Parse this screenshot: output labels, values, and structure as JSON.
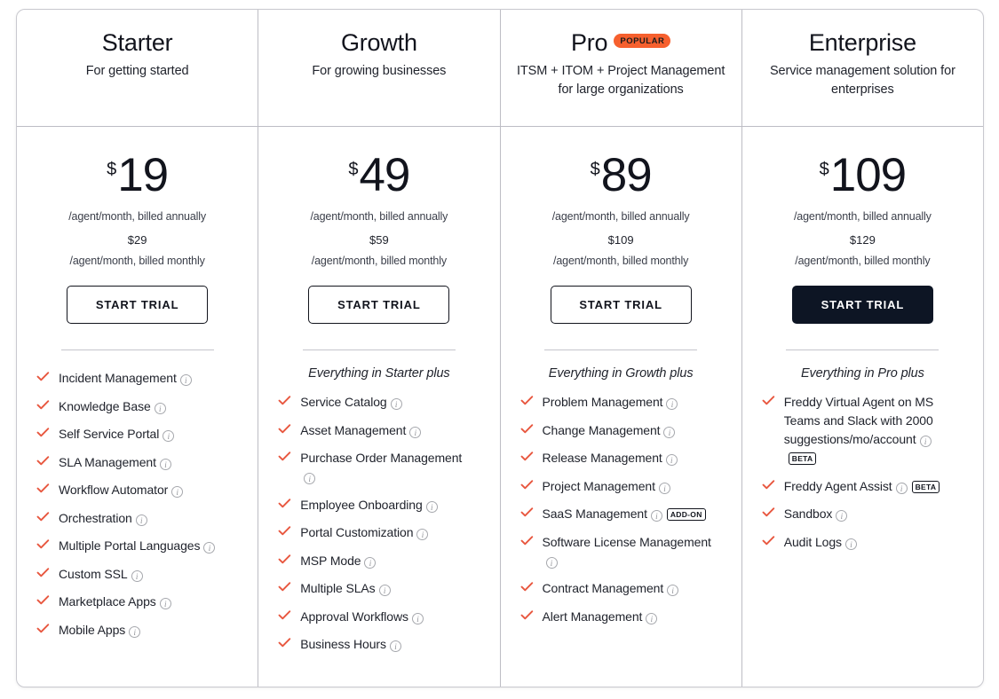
{
  "icons": {
    "check": "check-icon",
    "info": "info-icon"
  },
  "colors": {
    "check": "#e8573f",
    "popular_badge_bg": "#f6602e",
    "cta_filled_bg": "#0d1524",
    "text": "#21242d",
    "border": "#bdbdc4"
  },
  "plans": [
    {
      "name": "Starter",
      "badge": null,
      "tagline": "For getting started",
      "currency": "$",
      "price": "19",
      "price_note": "/agent/month, billed annually",
      "price_alt": "$29",
      "price_alt_note": "/agent/month, billed monthly",
      "cta_label": "START TRIAL",
      "cta_filled": false,
      "inherits": null,
      "features": [
        {
          "label": "Incident Management",
          "info": true,
          "badge": null
        },
        {
          "label": "Knowledge Base",
          "info": true,
          "badge": null
        },
        {
          "label": "Self Service Portal",
          "info": true,
          "badge": null
        },
        {
          "label": "SLA Management",
          "info": true,
          "badge": null
        },
        {
          "label": "Workflow Automator",
          "info": true,
          "badge": null
        },
        {
          "label": "Orchestration",
          "info": true,
          "badge": null
        },
        {
          "label": "Multiple Portal Languages",
          "info": true,
          "badge": null
        },
        {
          "label": "Custom SSL",
          "info": true,
          "badge": null
        },
        {
          "label": "Marketplace Apps",
          "info": true,
          "badge": null
        },
        {
          "label": "Mobile Apps",
          "info": true,
          "badge": null
        }
      ]
    },
    {
      "name": "Growth",
      "badge": null,
      "tagline": "For growing businesses",
      "currency": "$",
      "price": "49",
      "price_note": "/agent/month, billed annually",
      "price_alt": "$59",
      "price_alt_note": "/agent/month, billed monthly",
      "cta_label": "START TRIAL",
      "cta_filled": false,
      "inherits": "Everything in Starter plus",
      "features": [
        {
          "label": "Service Catalog",
          "info": true,
          "badge": null
        },
        {
          "label": "Asset Management",
          "info": true,
          "badge": null
        },
        {
          "label": "Purchase Order Management",
          "info": true,
          "badge": null
        },
        {
          "label": "Employee Onboarding",
          "info": true,
          "badge": null
        },
        {
          "label": "Portal Customization",
          "info": true,
          "badge": null
        },
        {
          "label": "MSP Mode",
          "info": true,
          "badge": null
        },
        {
          "label": "Multiple SLAs",
          "info": true,
          "badge": null
        },
        {
          "label": "Approval Workflows",
          "info": true,
          "badge": null
        },
        {
          "label": "Business Hours",
          "info": true,
          "badge": null
        }
      ]
    },
    {
      "name": "Pro",
      "badge": "POPULAR",
      "tagline": "ITSM + ITOM + Project Management for large organizations",
      "currency": "$",
      "price": "89",
      "price_note": "/agent/month, billed annually",
      "price_alt": "$109",
      "price_alt_note": "/agent/month, billed monthly",
      "cta_label": "START TRIAL",
      "cta_filled": false,
      "inherits": "Everything in Growth plus",
      "features": [
        {
          "label": "Problem Management",
          "info": true,
          "badge": null
        },
        {
          "label": "Change Management",
          "info": true,
          "badge": null
        },
        {
          "label": "Release Management",
          "info": true,
          "badge": null
        },
        {
          "label": "Project Management",
          "info": true,
          "badge": null
        },
        {
          "label": "SaaS Management",
          "info": true,
          "badge": "ADD-ON"
        },
        {
          "label": "Software License Management",
          "info": true,
          "badge": null
        },
        {
          "label": "Contract Management",
          "info": true,
          "badge": null
        },
        {
          "label": "Alert Management",
          "info": true,
          "badge": null
        }
      ]
    },
    {
      "name": "Enterprise",
      "badge": null,
      "tagline": "Service management solution for enterprises",
      "currency": "$",
      "price": "109",
      "price_note": "/agent/month, billed annually",
      "price_alt": "$129",
      "price_alt_note": "/agent/month, billed monthly",
      "cta_label": "START TRIAL",
      "cta_filled": true,
      "inherits": "Everything in Pro plus",
      "features": [
        {
          "label": "Freddy Virtual Agent on MS Teams and Slack with 2000 suggestions/mo/account",
          "info": true,
          "badge": "BETA"
        },
        {
          "label": "Freddy Agent Assist",
          "info": true,
          "badge": "BETA"
        },
        {
          "label": "Sandbox",
          "info": true,
          "badge": null
        },
        {
          "label": "Audit Logs",
          "info": true,
          "badge": null
        }
      ]
    }
  ]
}
